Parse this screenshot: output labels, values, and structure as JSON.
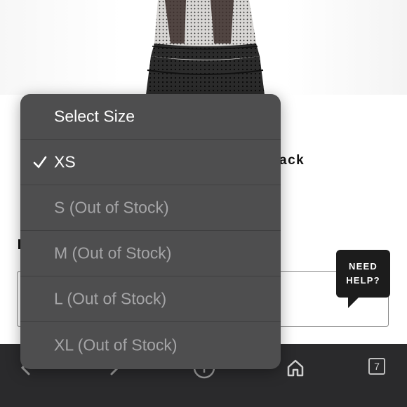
{
  "product": {
    "title_fragment": "ack"
  },
  "size_menu": {
    "header": "Select Size",
    "options": [
      {
        "label": "XS",
        "selected": true
      },
      {
        "label": "S (Out of Stock)",
        "selected": false
      },
      {
        "label": "M (Out of Stock)",
        "selected": false
      },
      {
        "label": "L (Out of Stock)",
        "selected": false
      },
      {
        "label": "XL (Out of Stock)",
        "selected": false
      }
    ]
  },
  "help": {
    "label": "NEED\nHELP?"
  },
  "toolbar": {
    "back_icon": "chevron-left-icon",
    "forward_icon": "chevron-right-icon",
    "share_icon": "circle-plus-icon",
    "home_icon": "home-icon",
    "tabs_count": "7"
  },
  "colors": {
    "menu_background": "#4e4e4f",
    "menu_text_disabled": "#a5a5a7",
    "menu_text_active": "#ffffff",
    "toolbar_background": "#2a2a2c",
    "help_bubble": "#1c1c1c"
  }
}
